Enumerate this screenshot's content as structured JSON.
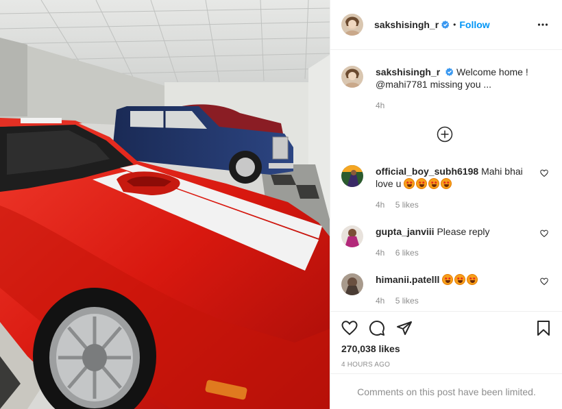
{
  "post": {
    "author": "sakshisingh_r",
    "follow_label": "Follow",
    "dot": "•",
    "caption_user": "sakshisingh_r",
    "caption_text": "Welcome home ! @mahi7781 missing you ...",
    "caption_time": "4h"
  },
  "comments": [
    {
      "user": "official_boy_subh6198",
      "text": "Mahi bhai love u",
      "emojis": 4,
      "time": "4h",
      "likes": "5 likes"
    },
    {
      "user": "gupta_janviii",
      "text": "Please reply",
      "emojis": 0,
      "time": "4h",
      "likes": "6 likes"
    },
    {
      "user": "himanii.patelll",
      "text": "",
      "emojis": 3,
      "time": "4h",
      "likes": "5 likes"
    }
  ],
  "footer": {
    "likes": "270,038 likes",
    "timestamp": "4 HOURS AGO",
    "comments_limited": "Comments on this post have been limited."
  },
  "icons": {
    "more": "more-options-icon",
    "load": "load-more-comments-icon",
    "like": "heart-icon",
    "comment": "comment-icon",
    "share": "share-icon",
    "save": "bookmark-icon",
    "verified": "verified-badge-icon"
  },
  "colors": {
    "accent": "#0095f6",
    "verified": "#3897f0",
    "muted": "#8e8e8e"
  }
}
